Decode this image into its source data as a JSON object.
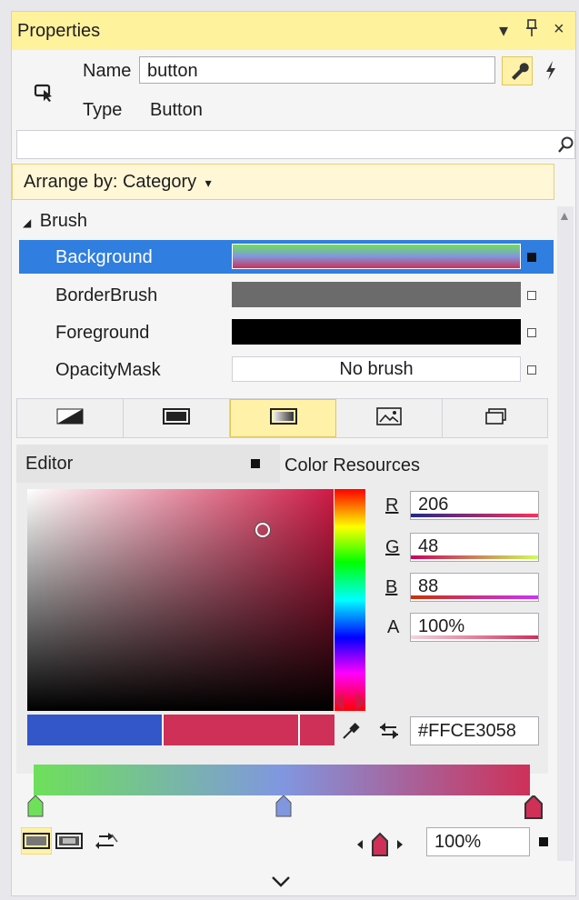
{
  "title": "Properties",
  "title_buttons": {
    "dropdown": "▾",
    "pin": "ᵖ",
    "close": "×"
  },
  "header": {
    "name_label": "Name",
    "name_value": "button",
    "type_label": "Type",
    "type_value": "Button"
  },
  "search": {
    "placeholder": ""
  },
  "arrange": {
    "label": "Arrange by: Category",
    "caret": "▾"
  },
  "brush": {
    "section_label": "Brush",
    "rows": [
      {
        "label": "Background",
        "selected": true,
        "swatch": "gradient"
      },
      {
        "label": "BorderBrush",
        "selected": false,
        "swatch": "#6b6b6b"
      },
      {
        "label": "Foreground",
        "selected": false,
        "swatch": "#000000"
      },
      {
        "label": "OpacityMask",
        "selected": false,
        "swatch": "No brush"
      }
    ],
    "no_brush_text": "No brush"
  },
  "brush_tabs": [
    {
      "icon": "null-brush-icon"
    },
    {
      "icon": "solid-brush-icon"
    },
    {
      "icon": "gradient-brush-icon",
      "active": true
    },
    {
      "icon": "image-brush-icon"
    },
    {
      "icon": "resource-brush-icon"
    }
  ],
  "editor": {
    "editor_tab": "Editor",
    "resources_tab": "Color Resources",
    "channels": {
      "r_label": "R",
      "r_value": "206",
      "g_label": "G",
      "g_value": "48",
      "b_label": "B",
      "b_value": "88",
      "a_label": "A",
      "a_value": "100%"
    },
    "hex_value": "#FFCE3058",
    "old_color": "#3357c8",
    "new_color": "#ce3058"
  },
  "gradient": {
    "stops": [
      "#6ee05a",
      "#8097e0",
      "#ce3058"
    ],
    "offset_value": "100%"
  },
  "colors": {
    "accent_selected": "#2f7ee0",
    "title_bar": "#fff29d"
  }
}
